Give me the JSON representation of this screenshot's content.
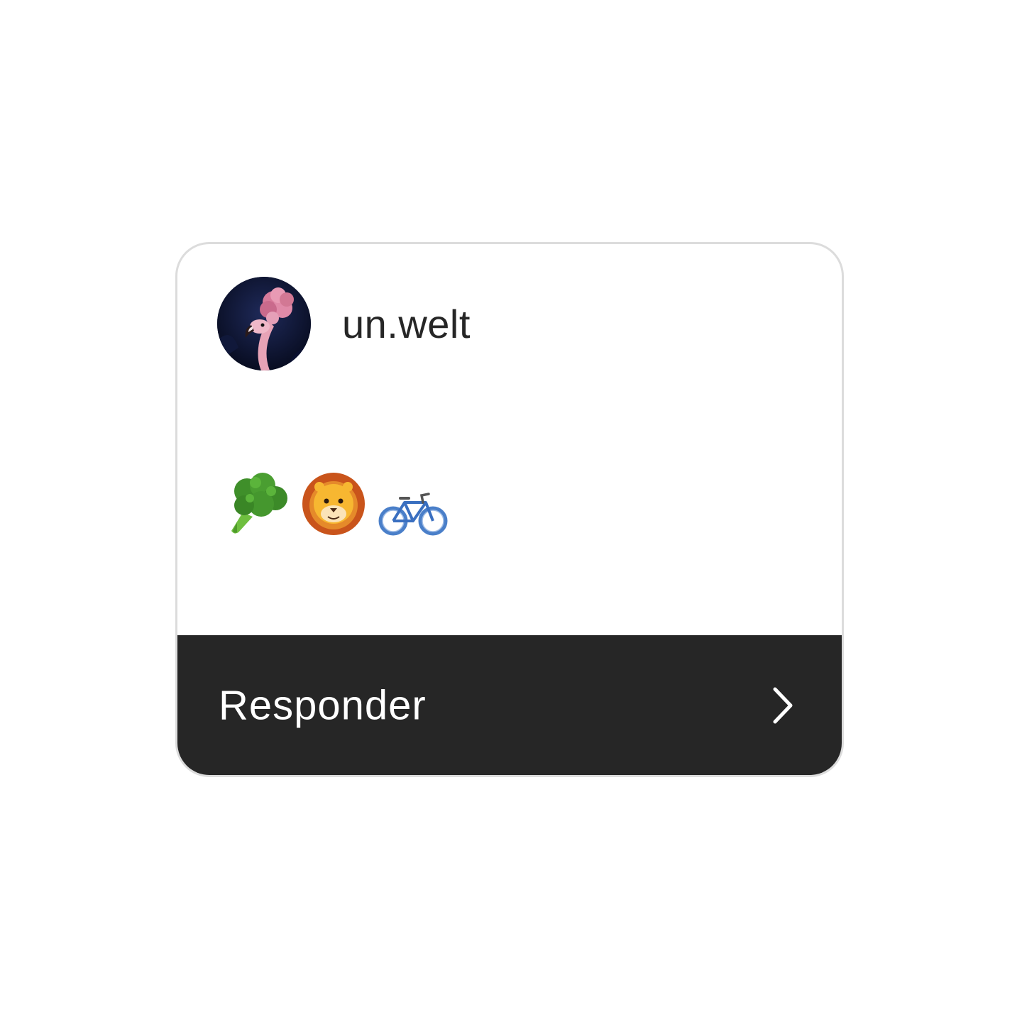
{
  "story_reply_card": {
    "username": "un.welt",
    "avatar": "flamingo-avatar",
    "emojis": [
      "broccoli-icon",
      "lion-face-icon",
      "bicycle-icon"
    ],
    "reply_label": "Responder",
    "reply_icon": "chevron-right-icon"
  },
  "colors": {
    "card_border": "#dcdcdc",
    "reply_bar_background": "#262626",
    "reply_text": "#ffffff",
    "username_text": "#262626"
  }
}
